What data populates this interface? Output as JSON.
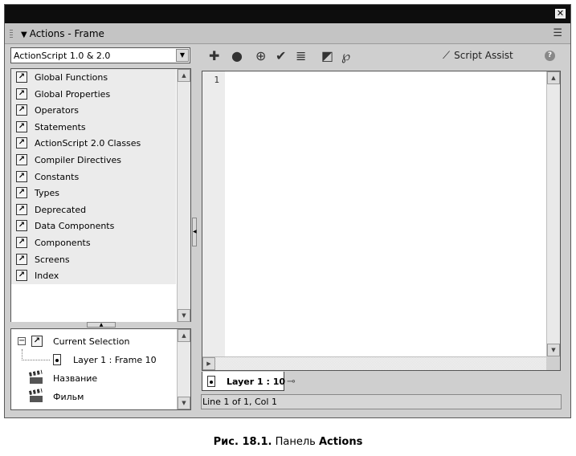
{
  "panel": {
    "title": "Actions - Frame",
    "close_glyph": "✕",
    "options_glyph": "☰"
  },
  "version_select": {
    "value": "ActionScript 1.0 & 2.0"
  },
  "toolbox": {
    "items": [
      {
        "label": "Global Functions",
        "icon": "book-icon"
      },
      {
        "label": "Global Properties",
        "icon": "book-icon"
      },
      {
        "label": "Operators",
        "icon": "book-icon"
      },
      {
        "label": "Statements",
        "icon": "book-icon"
      },
      {
        "label": "ActionScript 2.0 Classes",
        "icon": "book-icon"
      },
      {
        "label": "Compiler Directives",
        "icon": "book-icon"
      },
      {
        "label": "Constants",
        "icon": "book-icon"
      },
      {
        "label": "Types",
        "icon": "book-icon"
      },
      {
        "label": "Deprecated",
        "icon": "book-icon"
      },
      {
        "label": "Data Components",
        "icon": "book-icon"
      },
      {
        "label": "Components",
        "icon": "book-icon"
      },
      {
        "label": "Screens",
        "icon": "book-icon"
      },
      {
        "label": "Index",
        "icon": "index-icon"
      }
    ]
  },
  "navigator": {
    "current_selection": "Current Selection",
    "frame_item": "Layer 1 : Frame 10",
    "scene_items": [
      "Название",
      "Фильм"
    ]
  },
  "editor": {
    "line_number": "1",
    "toolbar_icons": [
      "add-statement-icon",
      "find-icon",
      "target-path-icon",
      "check-syntax-icon",
      "auto-format-icon",
      "code-hint-icon",
      "debug-options-icon"
    ],
    "script_assist_label": "Script Assist",
    "help_glyph": "?"
  },
  "script_tab": {
    "label": "Layer 1 : 10"
  },
  "status": {
    "text": "Line 1 of 1, Col 1"
  },
  "caption": {
    "prefix": "Рис. 18.1.",
    "middle": " Панель ",
    "bold": "Actions"
  }
}
